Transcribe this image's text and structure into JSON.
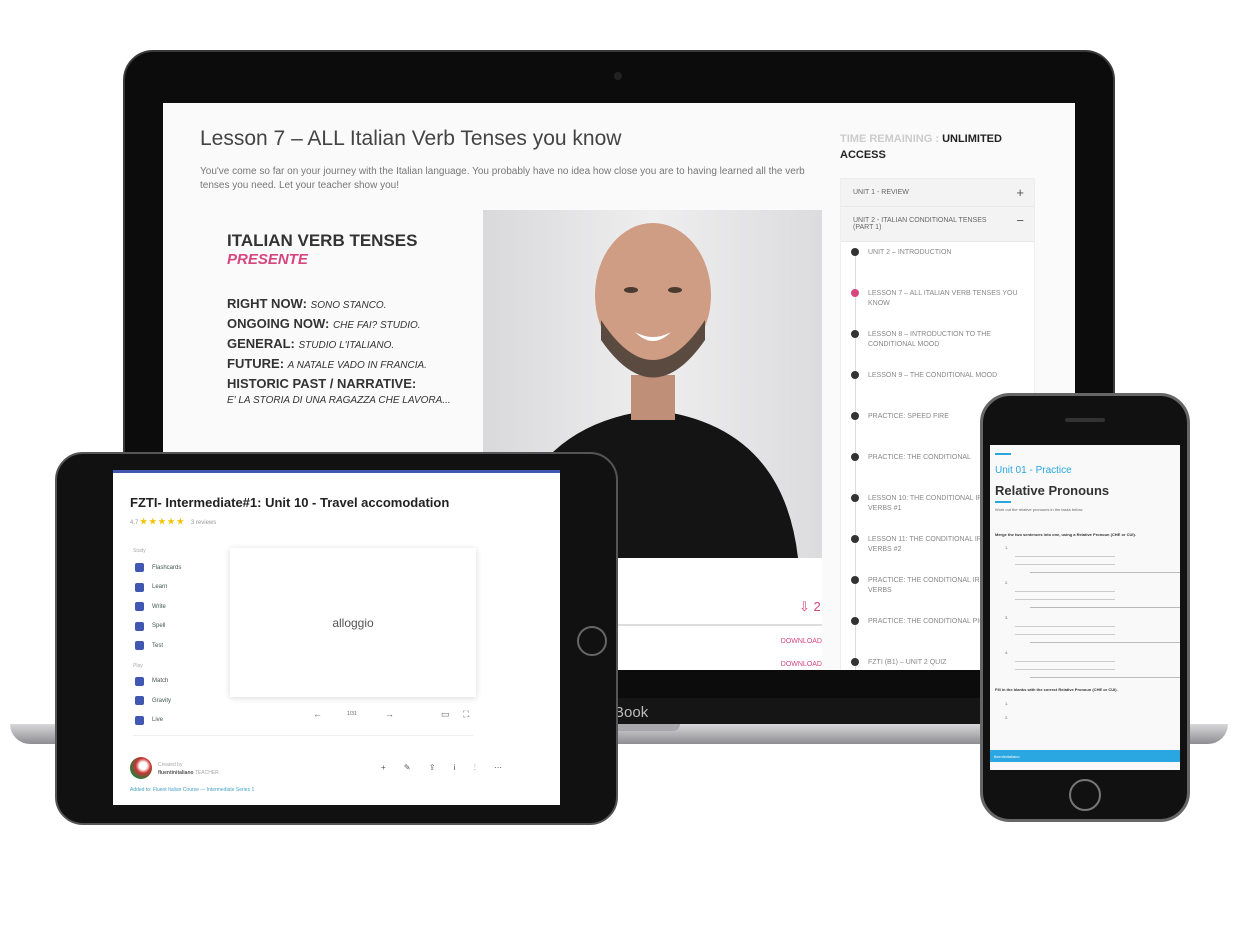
{
  "laptop": {
    "brand": "Book",
    "lesson_title": "Lesson 7 – ALL Italian Verb Tenses you know",
    "lesson_description": "You've come so far on your journey with the Italian language. You probably have no idea how close you are to having learned all the verb tenses you need. Let your teacher show you!",
    "slide": {
      "heading": "ITALIAN VERB TENSES",
      "subheading": "PRESENTE",
      "lines": [
        {
          "label": "RIGHT NOW:",
          "example": "SONO STANCO."
        },
        {
          "label": "ONGOING NOW:",
          "example": "CHE FAI? STUDIO."
        },
        {
          "label": "GENERAL:",
          "example": "STUDIO L'ITALIANO."
        },
        {
          "label": "FUTURE:",
          "example": "A NATALE VADO IN FRANCIA."
        },
        {
          "label": "HISTORIC PAST / NARRATIVE:",
          "example": ""
        }
      ],
      "last_example": "E' LA STORIA DI UNA RAGAZZA CHE LAVORA..."
    },
    "downloads_count": "2",
    "download_links": [
      "DOWNLOAD",
      "DOWNLOAD"
    ],
    "time_remaining_label": "TIME REMAINING :",
    "time_remaining_value": "UNLIMITED ACCESS",
    "units": [
      {
        "title": "UNIT 1 - REVIEW",
        "toggle": "+"
      },
      {
        "title": "UNIT 2 - ITALIAN CONDITIONAL TENSES (PART 1)",
        "toggle": "−"
      }
    ],
    "lessons": [
      {
        "title": "UNIT 2 – INTRODUCTION",
        "active": false
      },
      {
        "title": "LESSON 7 – ALL ITALIAN VERB TENSES YOU KNOW",
        "active": true
      },
      {
        "title": "LESSON 8 – INTRODUCTION TO THE CONDITIONAL MOOD",
        "active": false
      },
      {
        "title": "LESSON 9 – THE CONDITIONAL MOOD",
        "active": false
      },
      {
        "title": "PRACTICE: SPEED FIRE",
        "active": false
      },
      {
        "title": "PRACTICE: THE CONDITIONAL",
        "active": false
      },
      {
        "title": "LESSON 10: THE CONDITIONAL IRREGULAR VERBS #1",
        "active": false
      },
      {
        "title": "LESSON 11: THE CONDITIONAL IRREGULAR VERBS #2",
        "active": false
      },
      {
        "title": "PRACTICE: THE CONDITIONAL IRREGULAR VERBS",
        "active": false
      },
      {
        "title": "PRACTICE: THE CONDITIONAL PICTURES",
        "active": false
      },
      {
        "title": "FZTI (B1) – UNIT 2 QUIZ",
        "active": false
      }
    ],
    "accent": "#d6467f"
  },
  "tablet": {
    "title": "FZTI- Intermediate#1: Unit 10 - Travel accomodation",
    "rating": "4.7",
    "stars": "★★★★★",
    "reviews": "3 reviews",
    "study_label": "Study",
    "study_modes": [
      "Flashcards",
      "Learn",
      "Write",
      "Spell",
      "Test"
    ],
    "play_label": "Play",
    "play_modes": [
      "Match",
      "Gravity",
      "Live"
    ],
    "card_term": "alloggio",
    "card_position": "1/31",
    "prev": "←",
    "next": "→",
    "creator_label": "Created by",
    "creator": "fluentinitaliano",
    "creator_role": "TEACHER",
    "actions": "+ ✎ ⇪ i ⫶ ⋯",
    "added_to": "Added to: Fluent Italian Course — Intermediate Series 1",
    "accent": "#4257b2"
  },
  "phone": {
    "unit": "Unit 01 - Practice",
    "title": "Relative Pronouns",
    "instruction": "Work out the relative pronouns in the tasks below.",
    "section1": "Merge the two sentences into one, using a Relative Pronoun (CHE or CUI).",
    "items": [
      "1.",
      "2.",
      "3.",
      "4."
    ],
    "section2": "Fill in the blanks with the correct Relative Pronoun (CHE or CUI).",
    "fill_items": [
      "1.",
      "2."
    ],
    "footer": "fluentinitaliano",
    "accent": "#2aa6e0"
  }
}
